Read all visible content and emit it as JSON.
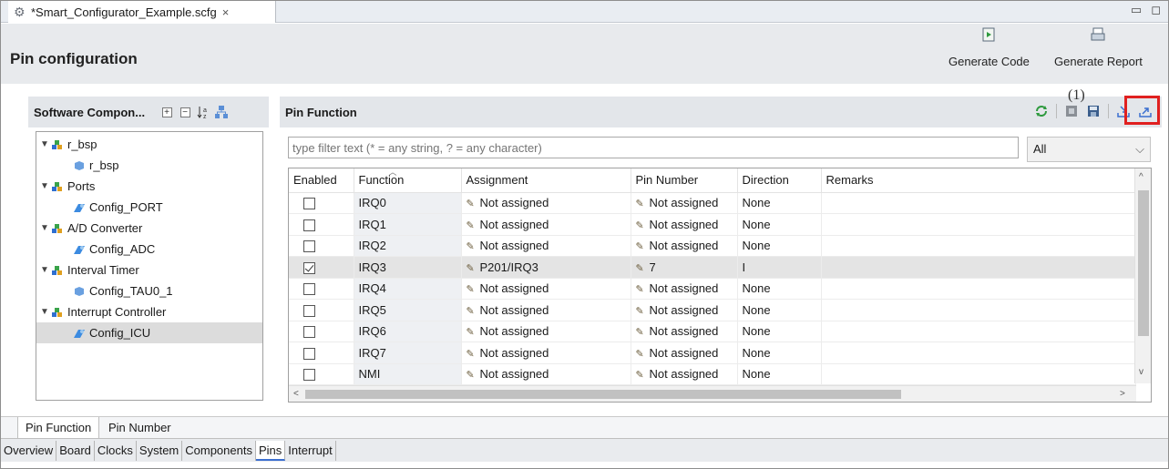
{
  "editor_tab": {
    "title": "*Smart_Configurator_Example.scfg",
    "close": "×"
  },
  "window_controls": {
    "minimize": "▭",
    "maximize": "◻"
  },
  "page_title": "Pin configuration",
  "toolbar": {
    "generate_code": "Generate Code",
    "generate_report": "Generate Report"
  },
  "software_panel": {
    "title": "Software Compon...",
    "filter_value": "",
    "tree": [
      {
        "label": "r_bsp",
        "level": 0,
        "expanded": true,
        "icon": "component-group-icon"
      },
      {
        "label": "r_bsp",
        "level": 1,
        "icon": "component-icon"
      },
      {
        "label": "Ports",
        "level": 0,
        "expanded": true,
        "icon": "component-group-icon"
      },
      {
        "label": "Config_PORT",
        "level": 1,
        "icon": "config-icon"
      },
      {
        "label": "A/D Converter",
        "level": 0,
        "expanded": true,
        "icon": "component-group-icon"
      },
      {
        "label": "Config_ADC",
        "level": 1,
        "icon": "config-icon"
      },
      {
        "label": "Interval Timer",
        "level": 0,
        "expanded": true,
        "icon": "component-group-icon"
      },
      {
        "label": "Config_TAU0_1",
        "level": 1,
        "icon": "component-icon"
      },
      {
        "label": "Interrupt Controller",
        "level": 0,
        "expanded": true,
        "icon": "component-group-icon"
      },
      {
        "label": "Config_ICU",
        "level": 1,
        "icon": "config-icon",
        "selected": true
      }
    ]
  },
  "pin_function": {
    "title": "Pin Function",
    "annotation": "(1)",
    "filter_placeholder": "type filter text (* = any string, ? = any character)",
    "filter_select": "All",
    "columns": [
      "Enabled",
      "Function",
      "Assignment",
      "Pin Number",
      "Direction",
      "Remarks"
    ],
    "rows": [
      {
        "enabled": false,
        "function": "IRQ0",
        "assignment": "Not assigned",
        "pin": "Not assigned",
        "direction": "None",
        "remarks": ""
      },
      {
        "enabled": false,
        "function": "IRQ1",
        "assignment": "Not assigned",
        "pin": "Not assigned",
        "direction": "None",
        "remarks": ""
      },
      {
        "enabled": false,
        "function": "IRQ2",
        "assignment": "Not assigned",
        "pin": "Not assigned",
        "direction": "None",
        "remarks": ""
      },
      {
        "enabled": true,
        "function": "IRQ3",
        "assignment": "P201/IRQ3",
        "pin": "7",
        "direction": "I",
        "remarks": ""
      },
      {
        "enabled": false,
        "function": "IRQ4",
        "assignment": "Not assigned",
        "pin": "Not assigned",
        "direction": "None",
        "remarks": ""
      },
      {
        "enabled": false,
        "function": "IRQ5",
        "assignment": "Not assigned",
        "pin": "Not assigned",
        "direction": "None",
        "remarks": ""
      },
      {
        "enabled": false,
        "function": "IRQ6",
        "assignment": "Not assigned",
        "pin": "Not assigned",
        "direction": "None",
        "remarks": ""
      },
      {
        "enabled": false,
        "function": "IRQ7",
        "assignment": "Not assigned",
        "pin": "Not assigned",
        "direction": "None",
        "remarks": ""
      },
      {
        "enabled": false,
        "function": "NMI",
        "assignment": "Not assigned",
        "pin": "Not assigned",
        "direction": "None",
        "remarks": ""
      }
    ]
  },
  "inner_tabs": [
    "Pin Function",
    "Pin Number"
  ],
  "page_tabs": [
    "Overview",
    "Board",
    "Clocks",
    "System",
    "Components",
    "Pins",
    "Interrupt"
  ],
  "active_page_tab": "Pins",
  "colors": {
    "accent": "#3b6fd0",
    "annotation_red": "#e02020",
    "header_bg": "#e8eaed",
    "panel_header_bg": "#e3e6ea"
  }
}
